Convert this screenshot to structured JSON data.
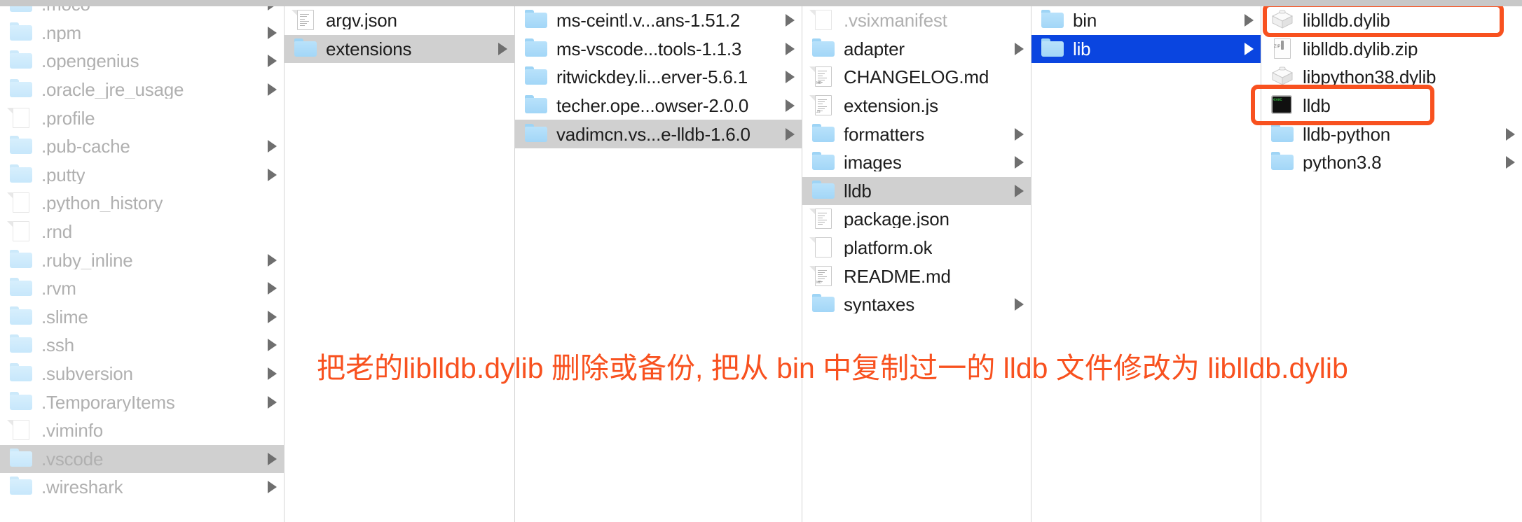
{
  "window": {
    "view": "finder-column-view",
    "selection_gray_color": "#d0d0d0",
    "selection_blue_color": "#0a45e0",
    "annotation_color": "#f8511f"
  },
  "columns": [
    {
      "name": "home-directory",
      "items": [
        {
          "label": ".moco",
          "icon": "folder-icon",
          "chevron": true,
          "state": "dim"
        },
        {
          "label": ".npm",
          "icon": "folder-icon",
          "chevron": true,
          "state": "dim"
        },
        {
          "label": ".opengenius",
          "icon": "folder-icon",
          "chevron": true,
          "state": "dim"
        },
        {
          "label": ".oracle_jre_usage",
          "icon": "folder-icon",
          "chevron": true,
          "state": "dim"
        },
        {
          "label": ".profile",
          "icon": "document-icon",
          "chevron": false,
          "state": "dim"
        },
        {
          "label": ".pub-cache",
          "icon": "folder-icon",
          "chevron": true,
          "state": "dim"
        },
        {
          "label": ".putty",
          "icon": "folder-icon",
          "chevron": true,
          "state": "dim"
        },
        {
          "label": ".python_history",
          "icon": "document-icon",
          "chevron": false,
          "state": "dim"
        },
        {
          "label": ".rnd",
          "icon": "document-icon",
          "chevron": false,
          "state": "dim"
        },
        {
          "label": ".ruby_inline",
          "icon": "folder-icon",
          "chevron": true,
          "state": "dim"
        },
        {
          "label": ".rvm",
          "icon": "folder-icon",
          "chevron": true,
          "state": "dim"
        },
        {
          "label": ".slime",
          "icon": "folder-icon",
          "chevron": true,
          "state": "dim"
        },
        {
          "label": ".ssh",
          "icon": "folder-icon",
          "chevron": true,
          "state": "dim"
        },
        {
          "label": ".subversion",
          "icon": "folder-icon",
          "chevron": true,
          "state": "dim"
        },
        {
          "label": ".TemporaryItems",
          "icon": "folder-icon",
          "chevron": true,
          "state": "dim"
        },
        {
          "label": ".viminfo",
          "icon": "document-icon",
          "chevron": false,
          "state": "dim"
        },
        {
          "label": ".vscode",
          "icon": "folder-icon",
          "chevron": true,
          "state": "dim",
          "selected": "gray"
        },
        {
          "label": ".wireshark",
          "icon": "folder-icon",
          "chevron": true,
          "state": "dim"
        }
      ]
    },
    {
      "name": "vscode-directory",
      "items": [
        {
          "label": "argv.json",
          "icon": "json-document-icon",
          "chevron": false,
          "state": "normal"
        },
        {
          "label": "extensions",
          "icon": "folder-icon",
          "chevron": true,
          "state": "normal",
          "selected": "gray"
        }
      ]
    },
    {
      "name": "extensions-directory",
      "items": [
        {
          "label": "ms-ceintl.v...ans-1.51.2",
          "icon": "folder-icon",
          "chevron": true,
          "state": "normal"
        },
        {
          "label": "ms-vscode...tools-1.1.3",
          "icon": "folder-icon",
          "chevron": true,
          "state": "normal"
        },
        {
          "label": "ritwickdey.li...erver-5.6.1",
          "icon": "folder-icon",
          "chevron": true,
          "state": "normal"
        },
        {
          "label": "techer.ope...owser-2.0.0",
          "icon": "folder-icon",
          "chevron": true,
          "state": "normal"
        },
        {
          "label": "vadimcn.vs...e-lldb-1.6.0",
          "icon": "folder-icon",
          "chevron": true,
          "state": "normal",
          "selected": "gray"
        }
      ]
    },
    {
      "name": "vscode-lldb-extension-directory",
      "items": [
        {
          "label": ".vsixmanifest",
          "icon": "document-icon",
          "chevron": false,
          "state": "dim"
        },
        {
          "label": "adapter",
          "icon": "folder-icon",
          "chevron": true,
          "state": "normal"
        },
        {
          "label": "CHANGELOG.md",
          "icon": "markdown-document-icon",
          "chevron": false,
          "state": "normal"
        },
        {
          "label": "extension.js",
          "icon": "js-document-icon",
          "chevron": false,
          "state": "normal"
        },
        {
          "label": "formatters",
          "icon": "folder-icon",
          "chevron": true,
          "state": "normal"
        },
        {
          "label": "images",
          "icon": "folder-icon",
          "chevron": true,
          "state": "normal"
        },
        {
          "label": "lldb",
          "icon": "folder-icon",
          "chevron": true,
          "state": "normal",
          "selected": "gray"
        },
        {
          "label": "package.json",
          "icon": "json-document-icon",
          "chevron": false,
          "state": "normal"
        },
        {
          "label": "platform.ok",
          "icon": "document-icon",
          "chevron": false,
          "state": "normal"
        },
        {
          "label": "README.md",
          "icon": "markdown-document-icon",
          "chevron": false,
          "state": "normal"
        },
        {
          "label": "syntaxes",
          "icon": "folder-icon",
          "chevron": true,
          "state": "normal"
        }
      ]
    },
    {
      "name": "lldb-directory",
      "items": [
        {
          "label": "bin",
          "icon": "folder-icon",
          "chevron": true,
          "state": "normal"
        },
        {
          "label": "lib",
          "icon": "folder-icon",
          "chevron": true,
          "state": "normal",
          "selected": "blue"
        }
      ]
    },
    {
      "name": "lib-directory",
      "items": [
        {
          "label": "liblldb.dylib",
          "icon": "dylib-icon",
          "chevron": false,
          "state": "normal"
        },
        {
          "label": "liblldb.dylib.zip",
          "icon": "zip-archive-icon",
          "chevron": false,
          "state": "normal"
        },
        {
          "label": "libpython38.dylib",
          "icon": "dylib-icon",
          "chevron": false,
          "state": "normal"
        },
        {
          "label": "lldb",
          "icon": "executable-icon",
          "chevron": false,
          "state": "normal"
        },
        {
          "label": "lldb-python",
          "icon": "folder-icon",
          "chevron": true,
          "state": "normal"
        },
        {
          "label": "python3.8",
          "icon": "folder-icon",
          "chevron": true,
          "state": "normal"
        }
      ]
    }
  ],
  "annotations": {
    "caption": "把老的liblldb.dylib 删除或备份, 把从 bin 中复制过一的 lldb 文件修改为 liblldb.dylib",
    "highlight_1_target": "liblldb.dylib",
    "highlight_2_target": "lldb"
  }
}
